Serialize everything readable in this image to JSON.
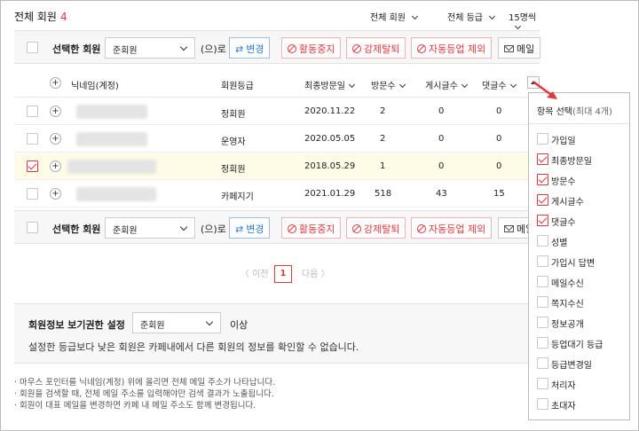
{
  "header": {
    "total_label": "전체 회원",
    "total_count": "4",
    "filters": [
      {
        "label": "전체 회원"
      },
      {
        "label": "전체 등급"
      },
      {
        "label": "15명씩"
      }
    ]
  },
  "action_bar": {
    "selected_label": "선택한 회원",
    "grade_select_value": "준회원",
    "suffix": "(으)로",
    "buttons": {
      "change": "변경",
      "suspend": "활동중지",
      "force_leave": "강제탈퇴",
      "auto_promote_exclude": "자동등업 제외",
      "mail": "메일"
    }
  },
  "table": {
    "columns": {
      "nickname": "닉네임(계정)",
      "grade": "회원등급",
      "last_visit": "최종방문일",
      "visits": "방문수",
      "posts": "게시글수",
      "comments": "댓글수"
    },
    "rows": [
      {
        "grade": "정회원",
        "last_visit": "2020.11.22",
        "visits": "2",
        "posts": "0",
        "comments": "0",
        "checked": false
      },
      {
        "grade": "운영자",
        "last_visit": "2020.05.05",
        "visits": "2",
        "posts": "0",
        "comments": "0",
        "checked": false
      },
      {
        "grade": "정회원",
        "last_visit": "2018.05.29",
        "visits": "1",
        "posts": "0",
        "comments": "0",
        "checked": true
      },
      {
        "grade": "카페지기",
        "last_visit": "2021.01.29",
        "visits": "518",
        "posts": "43",
        "comments": "15",
        "checked": false
      }
    ]
  },
  "pagination": {
    "prev": "〈 이전",
    "current": "1",
    "next": "다음 〉"
  },
  "permission": {
    "title": "회원정보 보기권한 설정",
    "select_value": "준회원",
    "suffix": "이상",
    "description": "설정한 등급보다 낮은 회원은 카페내에서 다른 회원의 정보를 확인할 수 없습니다."
  },
  "notes": [
    "· 마우스 포인터를 닉네임(계정) 위에 올리면 전체 메일 주소가 나타납니다.",
    "· 회원을 검색할 때, 전체 메일 주소를 입력해야만 검색 결과가 노출됩니다.",
    "· 회원이 대표 메일을 변경하면 카페 내 메일 주소도 함께 변경됩니다."
  ],
  "column_picker": {
    "title": "항목 선택",
    "subtitle": "(최대 4개)",
    "options": [
      {
        "label": "가입일",
        "checked": false
      },
      {
        "label": "최종방문일",
        "checked": true
      },
      {
        "label": "방문수",
        "checked": true
      },
      {
        "label": "게시글수",
        "checked": true
      },
      {
        "label": "댓글수",
        "checked": true
      },
      {
        "label": "성별",
        "checked": false
      },
      {
        "label": "가입시 답변",
        "checked": false
      },
      {
        "label": "메일수신",
        "checked": false
      },
      {
        "label": "쪽지수신",
        "checked": false
      },
      {
        "label": "정보공개",
        "checked": false
      },
      {
        "label": "등업대기 등급",
        "checked": false
      },
      {
        "label": "등급변경일",
        "checked": false
      },
      {
        "label": "처리자",
        "checked": false
      },
      {
        "label": "초대자",
        "checked": false
      }
    ]
  },
  "colors": {
    "accent": "#e0393e",
    "blue": "#2d79c7",
    "highlight_row": "#fefbe6",
    "panel_bg": "#f7f7f7"
  }
}
